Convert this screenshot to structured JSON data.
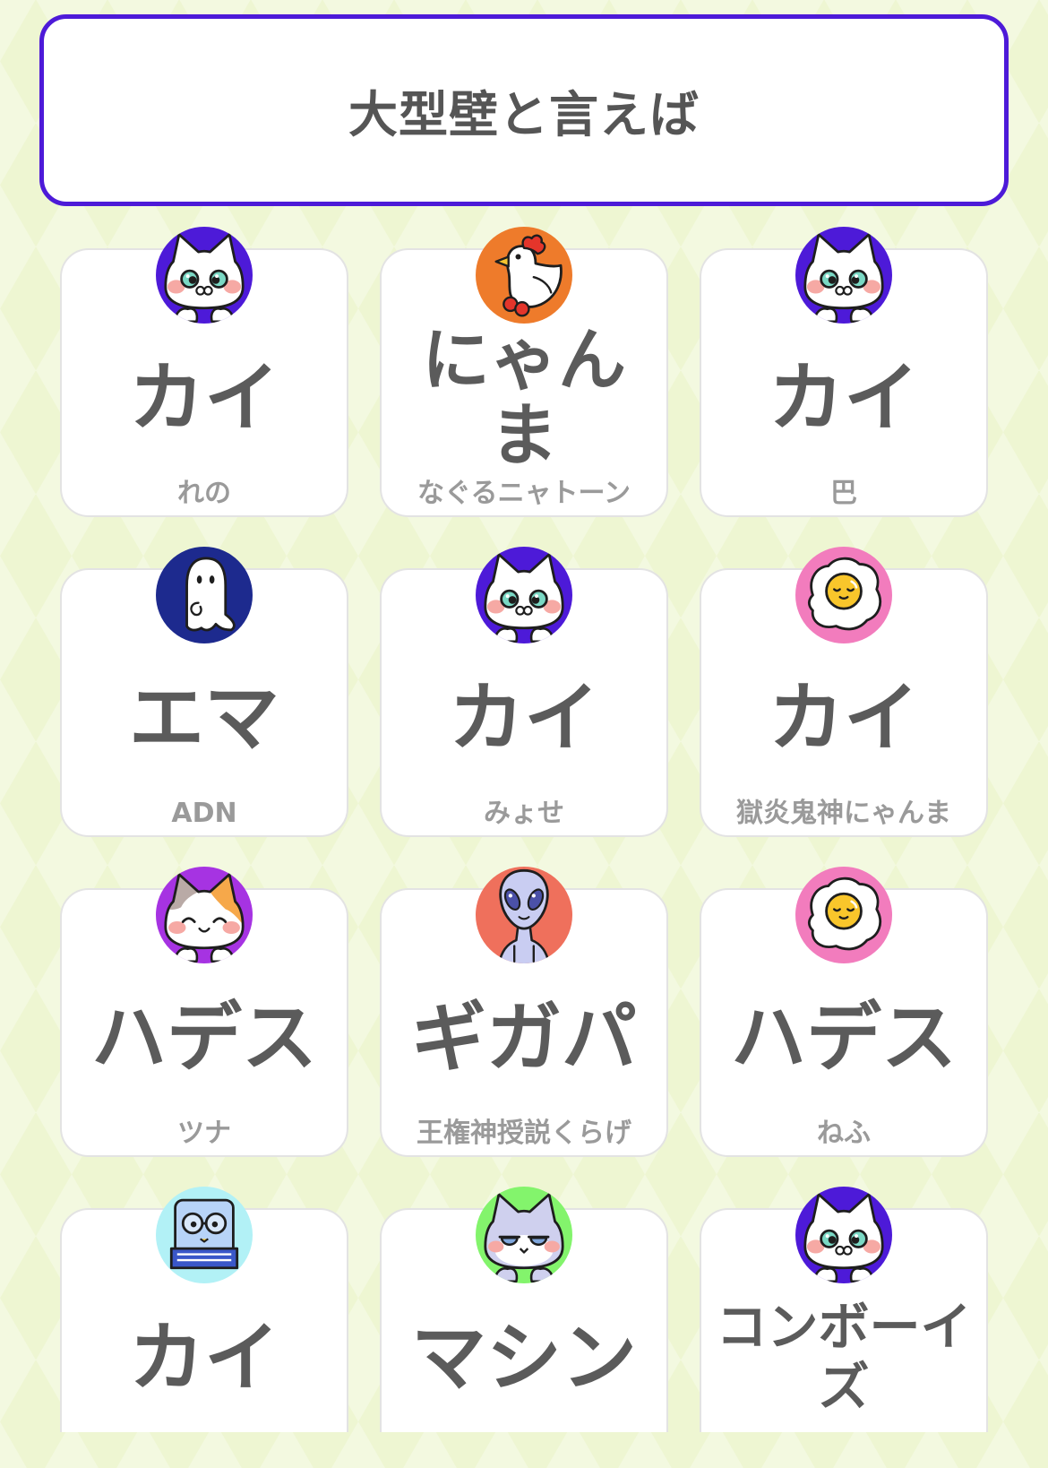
{
  "header": {
    "title": "大型壁と言えば"
  },
  "colors": {
    "accent": "#4d1ad8",
    "page_background": "#eef6d2",
    "answer_text": "#5b5b5b",
    "author_text": "#9a9a9a",
    "card_border": "#e3e3e3"
  },
  "cards": [
    {
      "name": "カイ",
      "author": "れの",
      "avatar_icon": "cat-icon",
      "avatar_bg": "#4d1ad8"
    },
    {
      "name": "にゃんま",
      "author": "なぐるニャトーン",
      "avatar_icon": "chicken-icon",
      "avatar_bg": "#ee7b2b"
    },
    {
      "name": "カイ",
      "author": "巴",
      "avatar_icon": "cat-icon",
      "avatar_bg": "#4d1ad8"
    },
    {
      "name": "エマ",
      "author": "ADN",
      "avatar_icon": "ghost-icon",
      "avatar_bg": "#1d2a8e"
    },
    {
      "name": "カイ",
      "author": "みょせ",
      "avatar_icon": "cat-icon",
      "avatar_bg": "#4d1ad8"
    },
    {
      "name": "カイ",
      "author": "獄炎鬼神にゃんま",
      "avatar_icon": "fried-egg-icon",
      "avatar_bg": "#f27cbd"
    },
    {
      "name": "ハデス",
      "author": "ツナ",
      "avatar_icon": "calico-cat-icon",
      "avatar_bg": "#a633e2"
    },
    {
      "name": "ギガパ",
      "author": "王権神授説くらげ",
      "avatar_icon": "alien-icon",
      "avatar_bg": "#ef705c"
    },
    {
      "name": "ハデス",
      "author": "ねふ",
      "avatar_icon": "fried-egg-icon",
      "avatar_bg": "#f27cbd"
    },
    {
      "name": "カイ",
      "avatar_icon": "book-icon",
      "avatar_bg": "#b2f1f6"
    },
    {
      "name": "マシン",
      "avatar_icon": "sleepy-cat-icon",
      "avatar_bg": "#83f46c"
    },
    {
      "name": "コンボーイズ",
      "avatar_icon": "cat-icon",
      "avatar_bg": "#4d1ad8"
    }
  ]
}
